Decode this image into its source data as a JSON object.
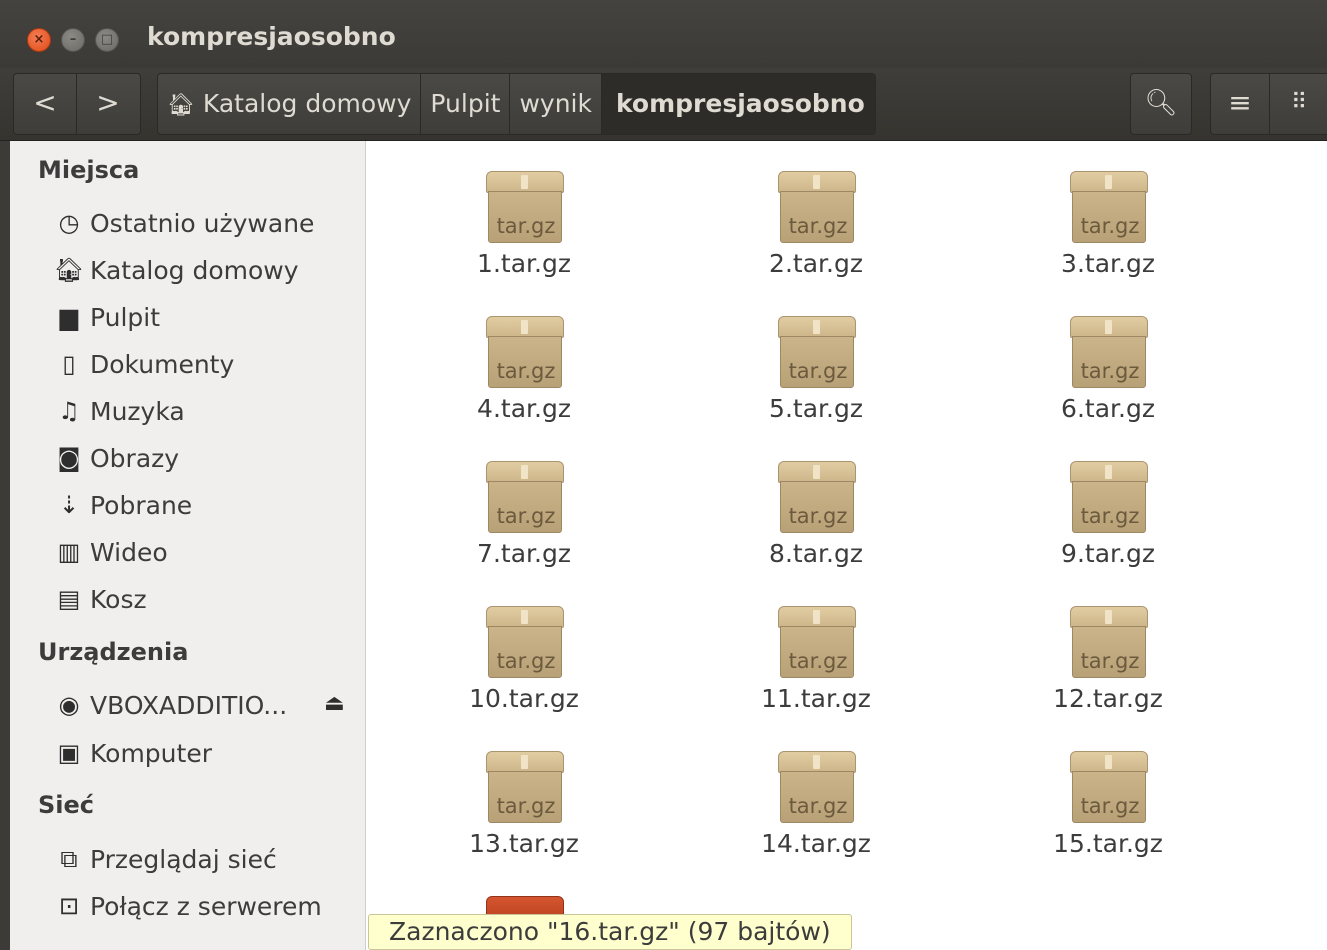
{
  "window": {
    "title": "kompresjaosobno"
  },
  "titlebar": {
    "close_glyph": "×",
    "minimize_glyph": "–",
    "maximize_glyph": "□"
  },
  "toolbar": {
    "back_glyph": "<",
    "forward_glyph": ">",
    "search_icon": "search-icon",
    "list_view_icon": "list-view-icon",
    "grid_view_icon": "grid-view-icon"
  },
  "breadcrumb": [
    {
      "label": "Katalog domowy",
      "icon": "home-icon"
    },
    {
      "label": "Pulpit"
    },
    {
      "label": "wynik"
    },
    {
      "label": "kompresjaosobno",
      "active": true
    }
  ],
  "sidebar": {
    "places_header": "Miejsca",
    "places": [
      {
        "label": "Ostatnio używane",
        "icon": "clock-icon"
      },
      {
        "label": "Katalog domowy",
        "icon": "home-icon"
      },
      {
        "label": "Pulpit",
        "icon": "folder-icon"
      },
      {
        "label": "Dokumenty",
        "icon": "document-icon"
      },
      {
        "label": "Muzyka",
        "icon": "music-icon"
      },
      {
        "label": "Obrazy",
        "icon": "camera-icon"
      },
      {
        "label": "Pobrane",
        "icon": "download-icon"
      },
      {
        "label": "Wideo",
        "icon": "film-icon"
      },
      {
        "label": "Kosz",
        "icon": "trash-icon"
      }
    ],
    "devices_header": "Urządzenia",
    "devices": [
      {
        "label": "VBOXADDITIO...",
        "icon": "disc-icon",
        "eject_icon": "eject-icon"
      },
      {
        "label": "Komputer",
        "icon": "computer-icon"
      }
    ],
    "network_header": "Sieć",
    "network": [
      {
        "label": "Przeglądaj sieć",
        "icon": "network-icon"
      },
      {
        "label": "Połącz z serwerem",
        "icon": "server-icon"
      }
    ]
  },
  "file_type_label": "tar.gz",
  "files": [
    "1.tar.gz",
    "2.tar.gz",
    "3.tar.gz",
    "4.tar.gz",
    "5.tar.gz",
    "6.tar.gz",
    "7.tar.gz",
    "8.tar.gz",
    "9.tar.gz",
    "10.tar.gz",
    "11.tar.gz",
    "12.tar.gz",
    "13.tar.gz",
    "14.tar.gz",
    "15.tar.gz"
  ],
  "status": {
    "text": "Zaznaczono \"16.tar.gz\"  (97 bajtów)"
  },
  "colors": {
    "accent_selected": "#c4502b",
    "sidebar_bg": "#f0efee",
    "titlebar_bg": "#3c3b37"
  }
}
